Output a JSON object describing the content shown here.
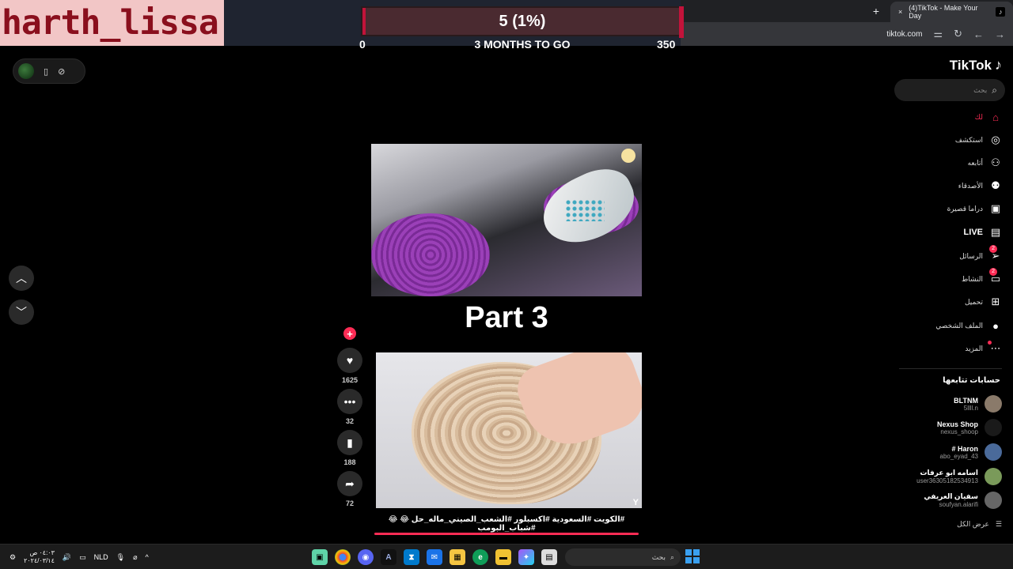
{
  "overlay": {
    "username": "harth_lissa"
  },
  "goal": {
    "label": "5 (1%)",
    "min": "0",
    "max": "350",
    "subtitle": "3 MONTHS TO GO",
    "fill_fraction": 0.01,
    "color": "#c2133a"
  },
  "browser": {
    "tab_title": "(4)TikTok - Make Your Day",
    "new_tab": "+",
    "close_tab": "×",
    "url": "tiktok.com"
  },
  "video": {
    "part_text": "Part 3",
    "caption": "#الكويت #السعودية #اكسبلور #الشعب_الصيني_ماله_حل 😂 😂 #شباب_البومب",
    "corner_badge": "Y"
  },
  "actions": {
    "follow": "+",
    "likes": "1625",
    "comments": "32",
    "saves": "188",
    "shares": "72"
  },
  "sidebar": {
    "brand": "TikTok",
    "search_placeholder": "بحث",
    "nav": [
      {
        "label": "لك",
        "icon": "home-icon",
        "active": true
      },
      {
        "label": "استكشف",
        "icon": "compass-icon"
      },
      {
        "label": "أتابعه",
        "icon": "user-follow-icon"
      },
      {
        "label": "الأصدقاء",
        "icon": "friends-icon"
      },
      {
        "label": "دراما قصيرة",
        "icon": "drama-icon"
      },
      {
        "label": "LIVE",
        "icon": "live-icon"
      },
      {
        "label": "الرسائل",
        "icon": "send-icon",
        "badge": "2"
      },
      {
        "label": "النشاط",
        "icon": "activity-icon",
        "badge": "2"
      },
      {
        "label": "تحميل",
        "icon": "upload-icon"
      },
      {
        "label": "الملف الشخصي",
        "icon": "profile-avatar-icon"
      },
      {
        "label": "المزيد",
        "icon": "more-icon"
      }
    ],
    "following_title": "حسابات تتابعها",
    "accounts": [
      {
        "name": "BLTNM",
        "handle": "5llll.n"
      },
      {
        "name": "Nexus Shop",
        "handle": "nexus_shoop"
      },
      {
        "name": "Haron #",
        "handle": "abo_eyad_43"
      },
      {
        "name": "اسامه ابو عرفات",
        "handle": "user36305182534913"
      },
      {
        "name": "سفيان العريفي",
        "handle": "soufyan.alarifi"
      }
    ],
    "see_all": "عرض الكل"
  },
  "taskbar": {
    "time": "٠٤:٠٣ ص",
    "date": "٢٠٢٤/٠٣/١٤",
    "lang": "NLD",
    "search_placeholder": "بحث"
  },
  "colors": {
    "accent": "#fe2c55",
    "background": "#000000"
  }
}
